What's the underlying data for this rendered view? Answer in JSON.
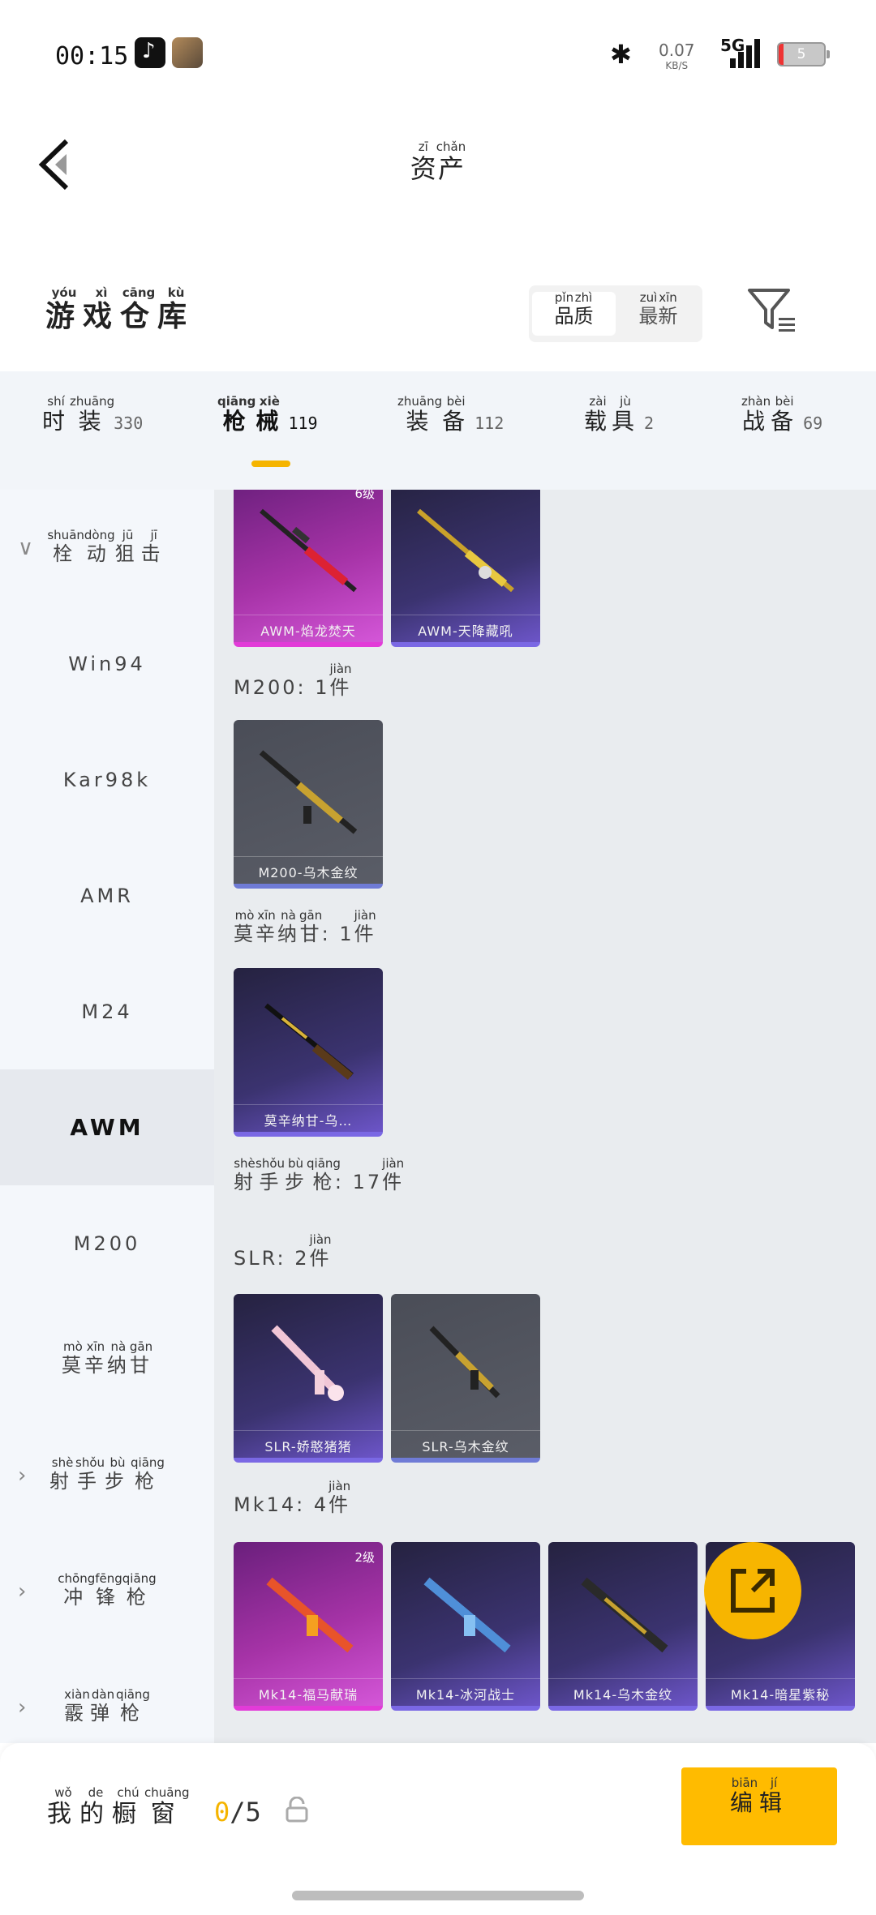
{
  "status": {
    "time": "00:15",
    "net_speed": "0.07",
    "net_unit": "KB/S",
    "network": "5G",
    "battery": "5"
  },
  "header": {
    "title": {
      "chars": [
        [
          "资",
          "zī"
        ],
        [
          "产",
          "chǎn"
        ]
      ]
    }
  },
  "repo": {
    "title": {
      "chars": [
        [
          "游",
          "yóu"
        ],
        [
          "戏",
          "xì"
        ],
        [
          "仓",
          "cāng"
        ],
        [
          "库",
          "kù"
        ]
      ]
    },
    "sort": [
      {
        "chars": [
          [
            "品",
            "pǐn"
          ],
          [
            "质",
            "zhì"
          ]
        ]
      },
      {
        "chars": [
          [
            "最",
            "zuì"
          ],
          [
            "新",
            "xīn"
          ]
        ]
      }
    ]
  },
  "categories": [
    {
      "chars": [
        [
          "时",
          "shí"
        ],
        [
          "装",
          "zhuāng"
        ]
      ],
      "count": "330"
    },
    {
      "chars": [
        [
          "枪",
          "qiāng"
        ],
        [
          "械",
          "xiè"
        ]
      ],
      "count": "119"
    },
    {
      "chars": [
        [
          "装",
          "zhuāng"
        ],
        [
          "备",
          "bèi"
        ]
      ],
      "count": "112"
    },
    {
      "chars": [
        [
          "载",
          "zài"
        ],
        [
          "具",
          "jù"
        ]
      ],
      "count": "2"
    },
    {
      "chars": [
        [
          "战",
          "zhàn"
        ],
        [
          "备",
          "bèi"
        ]
      ],
      "count": "69"
    }
  ],
  "sidebar": [
    {
      "text": "",
      "chars": [
        [
          "栓",
          "shuān"
        ],
        [
          "动",
          "dòng"
        ],
        [
          "狙",
          "jū"
        ],
        [
          "击",
          "jī"
        ]
      ],
      "expanded": true
    },
    {
      "text": "Win94"
    },
    {
      "text": "Kar98k"
    },
    {
      "text": "AMR"
    },
    {
      "text": "M24"
    },
    {
      "text": "AWM",
      "active": true
    },
    {
      "text": "M200"
    },
    {
      "text": "",
      "chars": [
        [
          "莫",
          "mò"
        ],
        [
          "辛",
          "xīn"
        ],
        [
          "纳",
          "nà"
        ],
        [
          "甘",
          "gān"
        ]
      ]
    },
    {
      "text": "",
      "chars": [
        [
          "射",
          "shè"
        ],
        [
          "手",
          "shǒu"
        ],
        [
          "步",
          "bù"
        ],
        [
          "枪",
          "qiāng"
        ]
      ],
      "collapsed": true
    },
    {
      "text": "",
      "chars": [
        [
          "冲",
          "chōng"
        ],
        [
          "锋",
          "fēng"
        ],
        [
          "枪",
          "qiāng"
        ]
      ],
      "collapsed": true
    },
    {
      "text": "",
      "chars": [
        [
          "霰",
          "xiàn"
        ],
        [
          "弹",
          "dàn"
        ],
        [
          "枪",
          "qiāng"
        ]
      ],
      "collapsed": true
    }
  ],
  "groups": {
    "m200": {
      "prefix": "M200: 1",
      "chars": [
        [
          "件",
          "jiàn"
        ]
      ]
    },
    "mosin": {
      "prefix": "",
      "chars": [
        [
          "莫",
          "mò"
        ],
        [
          "辛",
          "xīn"
        ],
        [
          "纳",
          "nà"
        ],
        [
          "甘",
          "gān"
        ]
      ],
      "suffix": ": 1",
      "chars2": [
        [
          "件",
          "jiàn"
        ]
      ]
    },
    "dmr": {
      "prefix": "",
      "chars": [
        [
          "射",
          "shè"
        ],
        [
          "手",
          "shǒu"
        ],
        [
          "步",
          "bù"
        ],
        [
          "枪",
          "qiāng"
        ]
      ],
      "suffix": ": 17",
      "chars2": [
        [
          "件",
          "jiàn"
        ]
      ]
    },
    "slr": {
      "prefix": "SLR: 2",
      "chars": [
        [
          "件",
          "jiàn"
        ]
      ]
    },
    "mk14": {
      "prefix": "Mk14: 4",
      "chars": [
        [
          "件",
          "jiàn"
        ]
      ]
    }
  },
  "cards": {
    "awm1": {
      "name": "AWM-焰龙焚天",
      "level": "6级"
    },
    "awm2": {
      "name": "AWM-天降藏吼"
    },
    "m200": {
      "name": "M200-乌木金纹"
    },
    "mosin": {
      "name": "莫辛纳甘-乌…"
    },
    "slr1": {
      "name": "SLR-娇憨猪猪"
    },
    "slr2": {
      "name": "SLR-乌木金纹"
    },
    "mk14a": {
      "name": "Mk14-福马献瑞",
      "level": "2级"
    },
    "mk14b": {
      "name": "Mk14-冰河战士"
    },
    "mk14c": {
      "name": "Mk14-乌木金纹"
    },
    "mk14d": {
      "name": "Mk14-暗星紫秘"
    }
  },
  "bottom": {
    "title": {
      "chars": [
        [
          "我",
          "wǒ"
        ],
        [
          "的",
          "de"
        ],
        [
          "橱",
          "chú"
        ],
        [
          "窗",
          "chuāng"
        ]
      ]
    },
    "count_current": "0",
    "count_total": "/5",
    "edit": {
      "chars": [
        [
          "编",
          "biān"
        ],
        [
          "辑",
          "jí"
        ]
      ]
    }
  },
  "colors": {
    "accent": "#f5b400",
    "edit_button": "#ffbb00",
    "rarity_purple": "#e23bd8",
    "rarity_violet": "#7a68e4"
  }
}
